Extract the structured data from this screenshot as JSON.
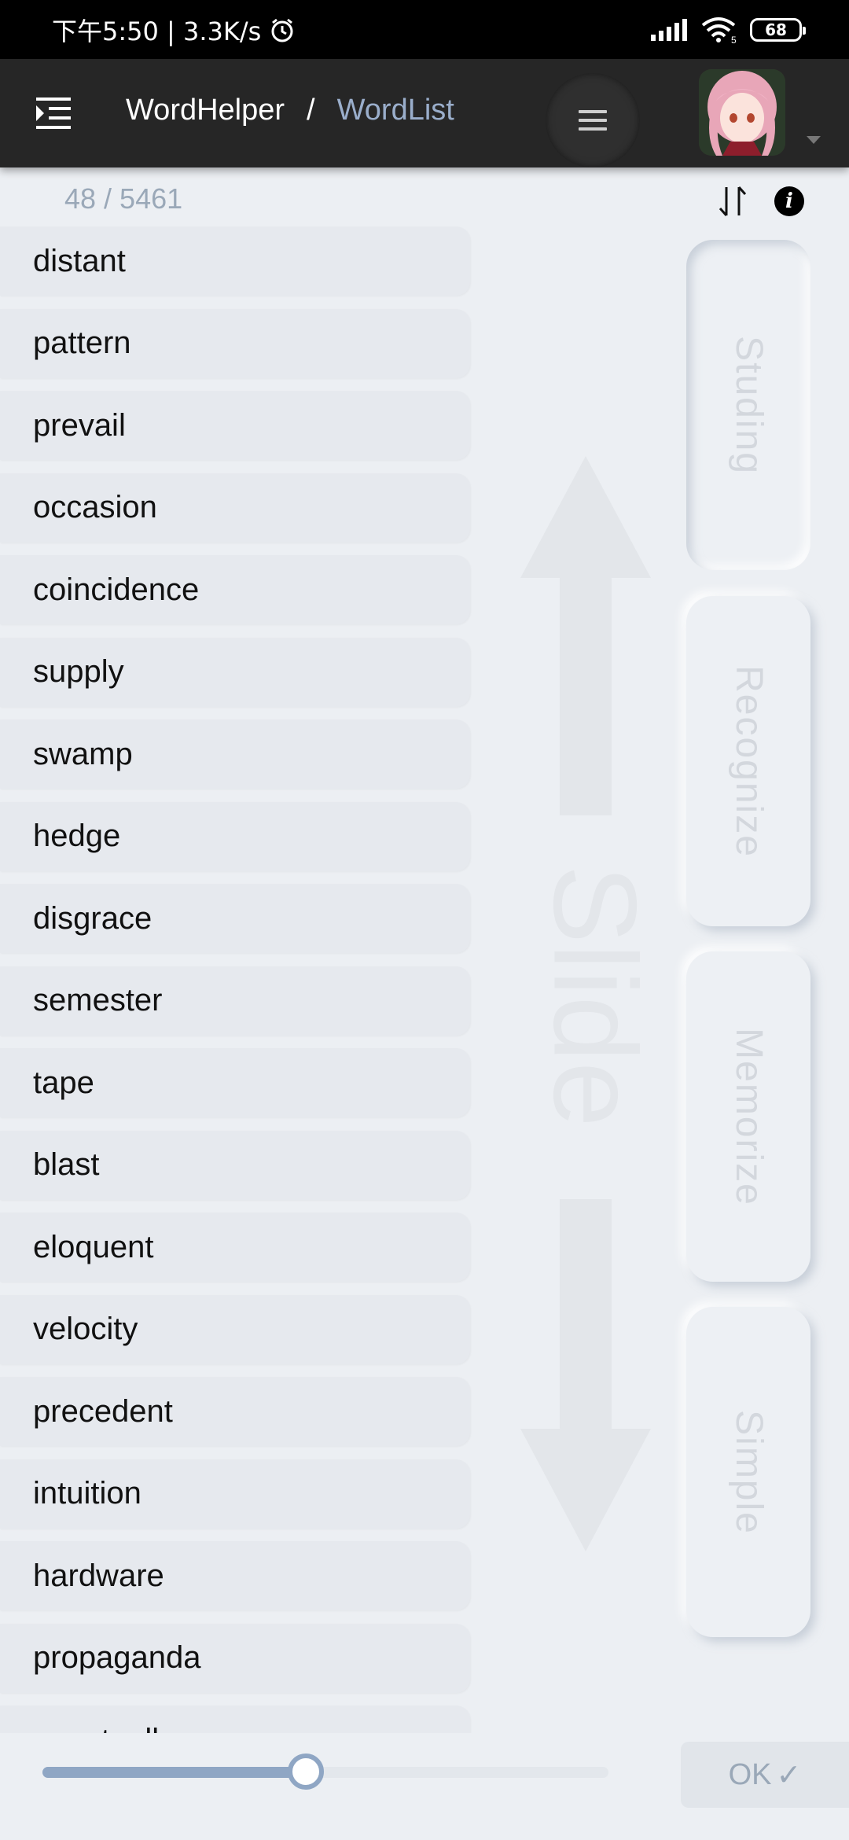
{
  "status_bar": {
    "time_info": "下午5:50 | 3.3K/s",
    "battery": "68",
    "wifi_label": "5"
  },
  "app_bar": {
    "app_name": "WordHelper",
    "separator": "/",
    "page_name": "WordList"
  },
  "list_header": {
    "counter": "48 / 5461"
  },
  "words": [
    "distant",
    "pattern",
    "prevail",
    "occasion",
    "coincidence",
    "supply",
    "swamp",
    "hedge",
    "disgrace",
    "semester",
    "tape",
    "blast",
    "eloquent",
    "velocity",
    "precedent",
    "intuition",
    "hardware",
    "propaganda",
    "eventually"
  ],
  "slide_hint": "Slide",
  "categories": [
    {
      "label": "Studing",
      "active": true
    },
    {
      "label": "Recognize",
      "active": false
    },
    {
      "label": "Memorize",
      "active": false
    },
    {
      "label": "Simple",
      "active": false
    }
  ],
  "bottom_bar": {
    "slider_value": 0.5,
    "ok_label": "OK",
    "ok_check": "✓"
  },
  "colors": {
    "accent": "#8fa6c4",
    "app_bar_bg": "#262626",
    "page_bg": "#eceff3"
  }
}
